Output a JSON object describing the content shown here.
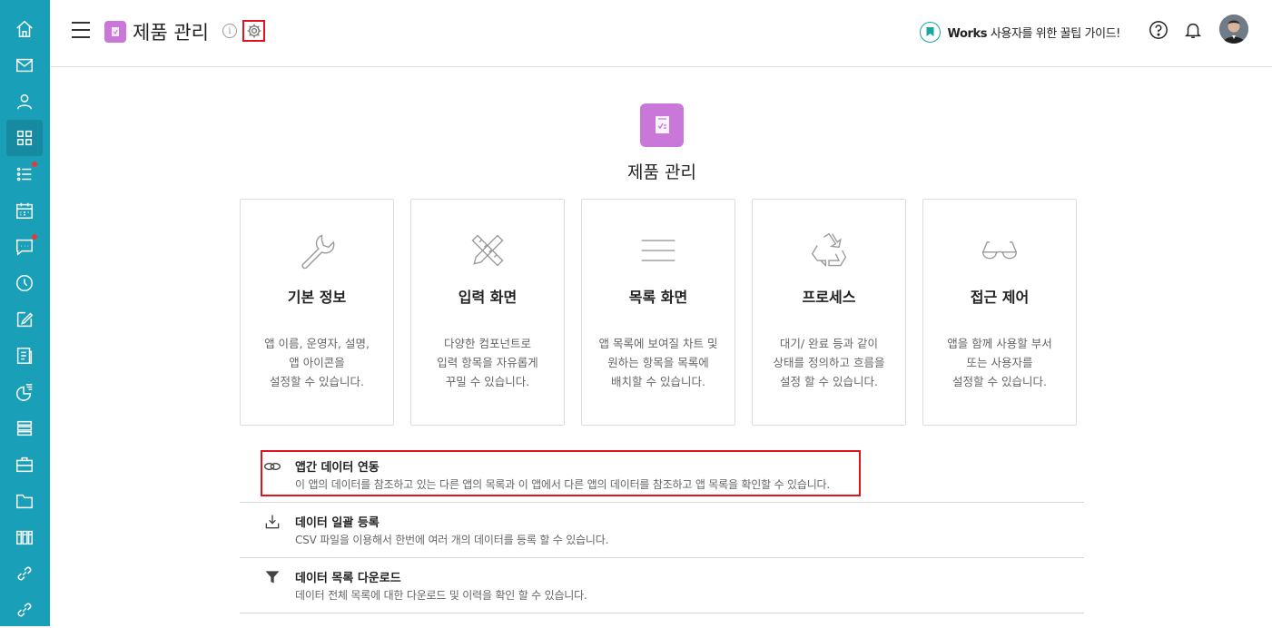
{
  "header": {
    "app_title": "제품 관리",
    "info_symbol": "i",
    "guide_brand": "Works",
    "guide_text": " 사용자를 위한 꿀팁 가이드!"
  },
  "hero": {
    "title": "제품 관리"
  },
  "cards": [
    {
      "icon": "wrench-icon",
      "title": "기본 정보",
      "desc": "앱 이름, 운영자, 설명,\n앱 아이콘을\n설정할 수 있습니다."
    },
    {
      "icon": "ruler-pencil-icon",
      "title": "입력 화면",
      "desc": "다양한 컴포넌트로\n입력 항목을 자유롭게\n꾸밀 수 있습니다."
    },
    {
      "icon": "list-lines-icon",
      "title": "목록 화면",
      "desc": "앱 목록에 보여질 차트 및\n원하는 항목을 목록에\n배치할 수 있습니다."
    },
    {
      "icon": "recycle-icon",
      "title": "프로세스",
      "desc": "대기/ 완료 등과 같이\n상태를 정의하고 흐름을\n설정 할 수 있습니다."
    },
    {
      "icon": "glasses-icon",
      "title": "접근 제어",
      "desc": "앱을 함께 사용할 부서\n또는 사용자를\n설정할 수 있습니다."
    }
  ],
  "rows": [
    {
      "icon": "link-icon",
      "title": "앱간 데이터 연동",
      "desc": "이 앱의 데이터를 참조하고 있는 다른 앱의 목록과 이 앱에서 다른 앱의 데이터를 참조하고 앱 목록을 확인할 수 있습니다."
    },
    {
      "icon": "upload-tray-icon",
      "title": "데이터 일괄 등록",
      "desc": "CSV 파일을 이용해서 한번에 여러 개의 데이터를 등록 할 수 있습니다."
    },
    {
      "icon": "filter-funnel-icon",
      "title": "데이터 목록 다운로드",
      "desc": "데이터 전체 목록에 대한 다운로드 및 이력을 확인 할 수 있습니다."
    }
  ],
  "colors": {
    "rail": "#1a9fb8",
    "app_badge": "#c977d9",
    "highlight": "#e0141e",
    "guide_accent": "#1aa6a0"
  },
  "rail_icons": [
    "home-icon",
    "mail-icon",
    "contacts-icon",
    "apps-grid-icon",
    "task-list-icon",
    "calendar-icon",
    "chat-icon",
    "clock-icon",
    "edit-icon",
    "board-icon",
    "chart-icon",
    "layers-icon",
    "briefcase-icon",
    "folder-icon",
    "library-icon",
    "link-icon",
    "link-icon"
  ]
}
